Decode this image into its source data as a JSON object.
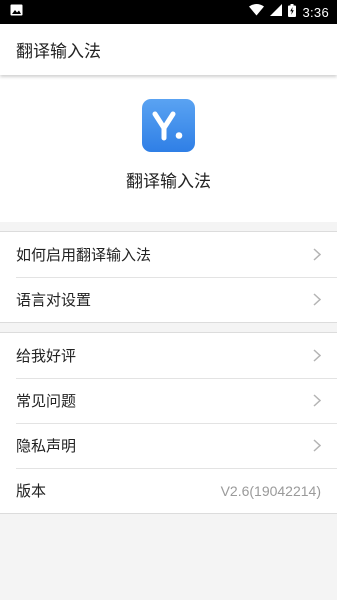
{
  "status_bar": {
    "time": "3:36",
    "icons": [
      "image-notification-icon",
      "wifi-icon",
      "signal-icon",
      "battery-charging-icon"
    ]
  },
  "app_bar": {
    "title": "翻译输入法"
  },
  "hero": {
    "logo_letter": "Y.",
    "app_name": "翻译输入法",
    "logo_color": "#3d8ded"
  },
  "groups": [
    {
      "items": [
        {
          "label": "如何启用翻译输入法"
        },
        {
          "label": "语言对设置"
        }
      ]
    },
    {
      "items": [
        {
          "label": "给我好评"
        },
        {
          "label": "常见问题"
        },
        {
          "label": "隐私声明"
        },
        {
          "label": "版本",
          "value": "V2.6(19042214)"
        }
      ]
    }
  ]
}
